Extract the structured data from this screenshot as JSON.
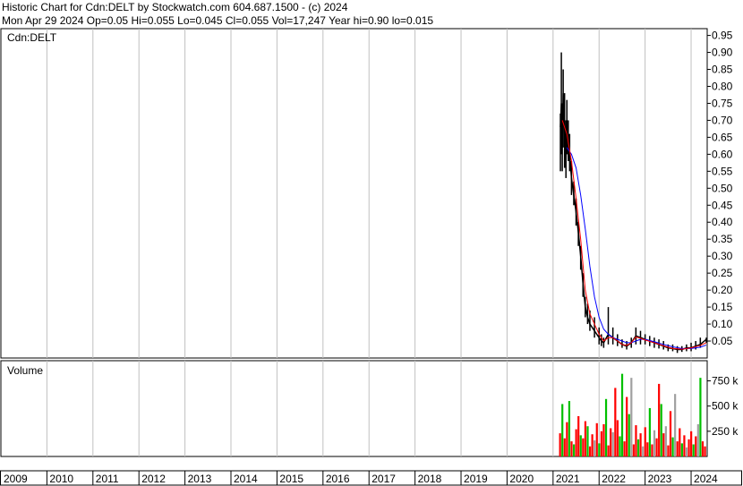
{
  "header": {
    "line1": "Historic Chart for Cdn:DELT by Stockwatch.com 604.687.1500 - (c) 2024",
    "line2": "Mon Apr 29 2024   Op=0.05  Hi=0.055  Lo=0.045  Cl=0.055  Vol=17,247  Year hi=0.90  lo=0.015"
  },
  "colors": {
    "price": "#000000",
    "ma_short": "#ff0000",
    "ma_long": "#0000ff",
    "up_volume": "#00c000",
    "down_volume": "#ff0000",
    "flat_volume": "#a0a0a0",
    "grid": "#c0c0c0"
  },
  "chart_data": [
    {
      "type": "line",
      "panel": "price",
      "symbol_label": "Cdn:DELT",
      "ylim": [
        0,
        0.97
      ],
      "y_ticks": [
        "0.95",
        "0.90",
        "0.85",
        "0.80",
        "0.75",
        "0.70",
        "0.65",
        "0.60",
        "0.55",
        "0.50",
        "0.45",
        "0.40",
        "0.35",
        "0.30",
        "0.25",
        "0.20",
        "0.15",
        "0.10",
        "0.05"
      ],
      "y_tick_values": [
        0.95,
        0.9,
        0.85,
        0.8,
        0.75,
        0.7,
        0.65,
        0.6,
        0.55,
        0.5,
        0.45,
        0.4,
        0.35,
        0.3,
        0.25,
        0.2,
        0.15,
        0.1,
        0.05
      ],
      "x_ticks": [
        "2009",
        "2010",
        "2011",
        "2012",
        "2013",
        "2014",
        "2015",
        "2016",
        "2017",
        "2018",
        "2019",
        "2020",
        "2021",
        "2022",
        "2023",
        "2024"
      ],
      "x_range": [
        2009.0,
        2024.33
      ],
      "series": [
        {
          "role": "price",
          "x": [
            2021.16,
            2021.18,
            2021.2,
            2021.22,
            2021.25,
            2021.28,
            2021.3,
            2021.33,
            2021.36,
            2021.4,
            2021.45,
            2021.5,
            2021.55,
            2021.6,
            2021.65,
            2021.7,
            2021.75,
            2021.8,
            2021.9,
            2022.0,
            2022.05,
            2022.1,
            2022.2,
            2022.3,
            2022.4,
            2022.5,
            2022.6,
            2022.7,
            2022.8,
            2022.9,
            2023.0,
            2023.1,
            2023.2,
            2023.3,
            2023.4,
            2023.5,
            2023.6,
            2023.7,
            2023.8,
            2023.9,
            2024.0,
            2024.1,
            2024.2,
            2024.33
          ],
          "y": [
            0.68,
            0.75,
            0.62,
            0.78,
            0.66,
            0.58,
            0.7,
            0.65,
            0.6,
            0.53,
            0.48,
            0.43,
            0.37,
            0.3,
            0.22,
            0.15,
            0.12,
            0.1,
            0.08,
            0.06,
            0.05,
            0.045,
            0.07,
            0.06,
            0.05,
            0.04,
            0.035,
            0.045,
            0.065,
            0.06,
            0.055,
            0.05,
            0.045,
            0.04,
            0.035,
            0.03,
            0.028,
            0.025,
            0.025,
            0.03,
            0.03,
            0.035,
            0.04,
            0.055
          ],
          "hi": [
            0.72,
            0.9,
            0.75,
            0.85,
            0.78,
            0.7,
            0.76,
            0.7,
            0.66,
            0.58,
            0.52,
            0.47,
            0.4,
            0.33,
            0.25,
            0.18,
            0.16,
            0.14,
            0.12,
            0.09,
            0.07,
            0.06,
            0.15,
            0.09,
            0.07,
            0.055,
            0.05,
            0.06,
            0.09,
            0.08,
            0.07,
            0.065,
            0.06,
            0.055,
            0.05,
            0.04,
            0.04,
            0.035,
            0.035,
            0.04,
            0.045,
            0.05,
            0.06,
            0.06
          ],
          "lo": [
            0.55,
            0.6,
            0.55,
            0.62,
            0.56,
            0.53,
            0.6,
            0.58,
            0.55,
            0.48,
            0.45,
            0.39,
            0.33,
            0.26,
            0.18,
            0.12,
            0.1,
            0.08,
            0.06,
            0.04,
            0.035,
            0.03,
            0.04,
            0.04,
            0.035,
            0.03,
            0.025,
            0.03,
            0.04,
            0.04,
            0.04,
            0.035,
            0.03,
            0.028,
            0.025,
            0.02,
            0.02,
            0.015,
            0.018,
            0.02,
            0.02,
            0.025,
            0.03,
            0.045
          ]
        },
        {
          "role": "ma_short",
          "x": [
            2021.2,
            2021.3,
            2021.4,
            2021.5,
            2021.6,
            2021.7,
            2021.8,
            2021.9,
            2022.0,
            2022.1,
            2022.2,
            2022.3,
            2022.4,
            2022.5,
            2022.6,
            2022.7,
            2022.8,
            2022.9,
            2023.0,
            2023.2,
            2023.4,
            2023.6,
            2023.8,
            2024.0,
            2024.2,
            2024.33
          ],
          "y": [
            0.7,
            0.66,
            0.58,
            0.47,
            0.35,
            0.2,
            0.13,
            0.1,
            0.07,
            0.05,
            0.06,
            0.06,
            0.05,
            0.04,
            0.037,
            0.045,
            0.062,
            0.058,
            0.053,
            0.045,
            0.036,
            0.028,
            0.026,
            0.03,
            0.037,
            0.045
          ]
        },
        {
          "role": "ma_long",
          "x": [
            2021.3,
            2021.4,
            2021.5,
            2021.6,
            2021.7,
            2021.8,
            2021.9,
            2022.0,
            2022.1,
            2022.2,
            2022.3,
            2022.4,
            2022.5,
            2022.6,
            2022.7,
            2022.8,
            2022.9,
            2023.0,
            2023.2,
            2023.4,
            2023.6,
            2023.8,
            2024.0,
            2024.2,
            2024.33
          ],
          "y": [
            0.62,
            0.6,
            0.56,
            0.48,
            0.38,
            0.27,
            0.18,
            0.12,
            0.085,
            0.07,
            0.06,
            0.055,
            0.05,
            0.045,
            0.045,
            0.05,
            0.055,
            0.055,
            0.048,
            0.04,
            0.033,
            0.028,
            0.028,
            0.032,
            0.038
          ]
        }
      ]
    },
    {
      "type": "bar",
      "panel": "volume",
      "title": "Volume",
      "ylim": [
        0,
        950000
      ],
      "y_ticks": [
        "750 k",
        "500 k",
        "250 k"
      ],
      "y_tick_values": [
        750000,
        500000,
        250000
      ],
      "bars": [
        {
          "x": 2021.15,
          "v": 230000,
          "c": "r"
        },
        {
          "x": 2021.2,
          "v": 520000,
          "c": "g"
        },
        {
          "x": 2021.25,
          "v": 180000,
          "c": "r"
        },
        {
          "x": 2021.3,
          "v": 340000,
          "c": "r"
        },
        {
          "x": 2021.35,
          "v": 550000,
          "c": "g"
        },
        {
          "x": 2021.4,
          "v": 150000,
          "c": "r"
        },
        {
          "x": 2021.45,
          "v": 120000,
          "c": "g"
        },
        {
          "x": 2021.5,
          "v": 270000,
          "c": "r"
        },
        {
          "x": 2021.55,
          "v": 400000,
          "c": "r"
        },
        {
          "x": 2021.6,
          "v": 210000,
          "c": "g"
        },
        {
          "x": 2021.65,
          "v": 180000,
          "c": "r"
        },
        {
          "x": 2021.7,
          "v": 350000,
          "c": "r"
        },
        {
          "x": 2021.75,
          "v": 300000,
          "c": "g"
        },
        {
          "x": 2021.8,
          "v": 100000,
          "c": "r"
        },
        {
          "x": 2021.85,
          "v": 220000,
          "c": "r"
        },
        {
          "x": 2021.9,
          "v": 160000,
          "c": "a"
        },
        {
          "x": 2021.95,
          "v": 330000,
          "c": "r"
        },
        {
          "x": 2022.0,
          "v": 130000,
          "c": "g"
        },
        {
          "x": 2022.05,
          "v": 250000,
          "c": "r"
        },
        {
          "x": 2022.1,
          "v": 320000,
          "c": "r"
        },
        {
          "x": 2022.15,
          "v": 570000,
          "c": "g"
        },
        {
          "x": 2022.2,
          "v": 110000,
          "c": "r"
        },
        {
          "x": 2022.25,
          "v": 280000,
          "c": "r"
        },
        {
          "x": 2022.3,
          "v": 240000,
          "c": "a"
        },
        {
          "x": 2022.35,
          "v": 680000,
          "c": "r"
        },
        {
          "x": 2022.4,
          "v": 360000,
          "c": "r"
        },
        {
          "x": 2022.45,
          "v": 200000,
          "c": "g"
        },
        {
          "x": 2022.5,
          "v": 820000,
          "c": "g"
        },
        {
          "x": 2022.55,
          "v": 150000,
          "c": "r"
        },
        {
          "x": 2022.6,
          "v": 590000,
          "c": "r"
        },
        {
          "x": 2022.65,
          "v": 420000,
          "c": "g"
        },
        {
          "x": 2022.7,
          "v": 780000,
          "c": "a"
        },
        {
          "x": 2022.75,
          "v": 120000,
          "c": "r"
        },
        {
          "x": 2022.8,
          "v": 310000,
          "c": "r"
        },
        {
          "x": 2022.85,
          "v": 170000,
          "c": "g"
        },
        {
          "x": 2022.9,
          "v": 230000,
          "c": "r"
        },
        {
          "x": 2022.95,
          "v": 100000,
          "c": "a"
        },
        {
          "x": 2023.0,
          "v": 290000,
          "c": "r"
        },
        {
          "x": 2023.05,
          "v": 140000,
          "c": "r"
        },
        {
          "x": 2023.1,
          "v": 480000,
          "c": "g"
        },
        {
          "x": 2023.15,
          "v": 120000,
          "c": "r"
        },
        {
          "x": 2023.2,
          "v": 260000,
          "c": "a"
        },
        {
          "x": 2023.25,
          "v": 180000,
          "c": "r"
        },
        {
          "x": 2023.3,
          "v": 720000,
          "c": "r"
        },
        {
          "x": 2023.35,
          "v": 520000,
          "c": "g"
        },
        {
          "x": 2023.4,
          "v": 230000,
          "c": "r"
        },
        {
          "x": 2023.45,
          "v": 300000,
          "c": "a"
        },
        {
          "x": 2023.5,
          "v": 110000,
          "c": "r"
        },
        {
          "x": 2023.55,
          "v": 450000,
          "c": "r"
        },
        {
          "x": 2023.6,
          "v": 190000,
          "c": "g"
        },
        {
          "x": 2023.65,
          "v": 620000,
          "c": "a"
        },
        {
          "x": 2023.7,
          "v": 150000,
          "c": "r"
        },
        {
          "x": 2023.75,
          "v": 280000,
          "c": "r"
        },
        {
          "x": 2023.8,
          "v": 130000,
          "c": "g"
        },
        {
          "x": 2023.85,
          "v": 210000,
          "c": "r"
        },
        {
          "x": 2023.9,
          "v": 90000,
          "c": "a"
        },
        {
          "x": 2023.95,
          "v": 170000,
          "c": "r"
        },
        {
          "x": 2024.0,
          "v": 250000,
          "c": "r"
        },
        {
          "x": 2024.05,
          "v": 120000,
          "c": "g"
        },
        {
          "x": 2024.1,
          "v": 200000,
          "c": "r"
        },
        {
          "x": 2024.15,
          "v": 320000,
          "c": "a"
        },
        {
          "x": 2024.2,
          "v": 780000,
          "c": "g"
        },
        {
          "x": 2024.25,
          "v": 150000,
          "c": "r"
        },
        {
          "x": 2024.3,
          "v": 100000,
          "c": "r"
        }
      ]
    }
  ]
}
